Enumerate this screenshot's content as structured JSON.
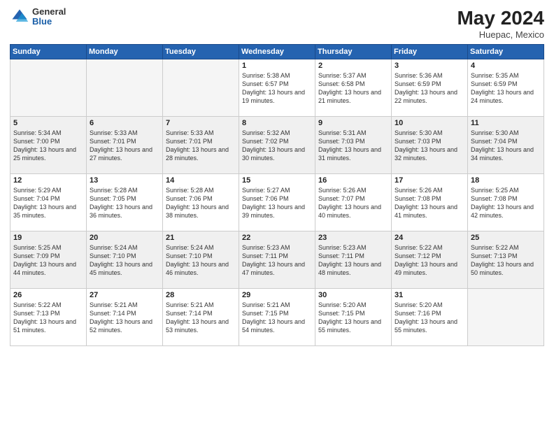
{
  "header": {
    "logo_general": "General",
    "logo_blue": "Blue",
    "title": "May 2024",
    "location": "Huepac, Mexico"
  },
  "days_of_week": [
    "Sunday",
    "Monday",
    "Tuesday",
    "Wednesday",
    "Thursday",
    "Friday",
    "Saturday"
  ],
  "weeks": [
    [
      {
        "day": "",
        "info": ""
      },
      {
        "day": "",
        "info": ""
      },
      {
        "day": "",
        "info": ""
      },
      {
        "day": "1",
        "info": "Sunrise: 5:38 AM\nSunset: 6:57 PM\nDaylight: 13 hours\nand 19 minutes."
      },
      {
        "day": "2",
        "info": "Sunrise: 5:37 AM\nSunset: 6:58 PM\nDaylight: 13 hours\nand 21 minutes."
      },
      {
        "day": "3",
        "info": "Sunrise: 5:36 AM\nSunset: 6:59 PM\nDaylight: 13 hours\nand 22 minutes."
      },
      {
        "day": "4",
        "info": "Sunrise: 5:35 AM\nSunset: 6:59 PM\nDaylight: 13 hours\nand 24 minutes."
      }
    ],
    [
      {
        "day": "5",
        "info": "Sunrise: 5:34 AM\nSunset: 7:00 PM\nDaylight: 13 hours\nand 25 minutes."
      },
      {
        "day": "6",
        "info": "Sunrise: 5:33 AM\nSunset: 7:01 PM\nDaylight: 13 hours\nand 27 minutes."
      },
      {
        "day": "7",
        "info": "Sunrise: 5:33 AM\nSunset: 7:01 PM\nDaylight: 13 hours\nand 28 minutes."
      },
      {
        "day": "8",
        "info": "Sunrise: 5:32 AM\nSunset: 7:02 PM\nDaylight: 13 hours\nand 30 minutes."
      },
      {
        "day": "9",
        "info": "Sunrise: 5:31 AM\nSunset: 7:03 PM\nDaylight: 13 hours\nand 31 minutes."
      },
      {
        "day": "10",
        "info": "Sunrise: 5:30 AM\nSunset: 7:03 PM\nDaylight: 13 hours\nand 32 minutes."
      },
      {
        "day": "11",
        "info": "Sunrise: 5:30 AM\nSunset: 7:04 PM\nDaylight: 13 hours\nand 34 minutes."
      }
    ],
    [
      {
        "day": "12",
        "info": "Sunrise: 5:29 AM\nSunset: 7:04 PM\nDaylight: 13 hours\nand 35 minutes."
      },
      {
        "day": "13",
        "info": "Sunrise: 5:28 AM\nSunset: 7:05 PM\nDaylight: 13 hours\nand 36 minutes."
      },
      {
        "day": "14",
        "info": "Sunrise: 5:28 AM\nSunset: 7:06 PM\nDaylight: 13 hours\nand 38 minutes."
      },
      {
        "day": "15",
        "info": "Sunrise: 5:27 AM\nSunset: 7:06 PM\nDaylight: 13 hours\nand 39 minutes."
      },
      {
        "day": "16",
        "info": "Sunrise: 5:26 AM\nSunset: 7:07 PM\nDaylight: 13 hours\nand 40 minutes."
      },
      {
        "day": "17",
        "info": "Sunrise: 5:26 AM\nSunset: 7:08 PM\nDaylight: 13 hours\nand 41 minutes."
      },
      {
        "day": "18",
        "info": "Sunrise: 5:25 AM\nSunset: 7:08 PM\nDaylight: 13 hours\nand 42 minutes."
      }
    ],
    [
      {
        "day": "19",
        "info": "Sunrise: 5:25 AM\nSunset: 7:09 PM\nDaylight: 13 hours\nand 44 minutes."
      },
      {
        "day": "20",
        "info": "Sunrise: 5:24 AM\nSunset: 7:10 PM\nDaylight: 13 hours\nand 45 minutes."
      },
      {
        "day": "21",
        "info": "Sunrise: 5:24 AM\nSunset: 7:10 PM\nDaylight: 13 hours\nand 46 minutes."
      },
      {
        "day": "22",
        "info": "Sunrise: 5:23 AM\nSunset: 7:11 PM\nDaylight: 13 hours\nand 47 minutes."
      },
      {
        "day": "23",
        "info": "Sunrise: 5:23 AM\nSunset: 7:11 PM\nDaylight: 13 hours\nand 48 minutes."
      },
      {
        "day": "24",
        "info": "Sunrise: 5:22 AM\nSunset: 7:12 PM\nDaylight: 13 hours\nand 49 minutes."
      },
      {
        "day": "25",
        "info": "Sunrise: 5:22 AM\nSunset: 7:13 PM\nDaylight: 13 hours\nand 50 minutes."
      }
    ],
    [
      {
        "day": "26",
        "info": "Sunrise: 5:22 AM\nSunset: 7:13 PM\nDaylight: 13 hours\nand 51 minutes."
      },
      {
        "day": "27",
        "info": "Sunrise: 5:21 AM\nSunset: 7:14 PM\nDaylight: 13 hours\nand 52 minutes."
      },
      {
        "day": "28",
        "info": "Sunrise: 5:21 AM\nSunset: 7:14 PM\nDaylight: 13 hours\nand 53 minutes."
      },
      {
        "day": "29",
        "info": "Sunrise: 5:21 AM\nSunset: 7:15 PM\nDaylight: 13 hours\nand 54 minutes."
      },
      {
        "day": "30",
        "info": "Sunrise: 5:20 AM\nSunset: 7:15 PM\nDaylight: 13 hours\nand 55 minutes."
      },
      {
        "day": "31",
        "info": "Sunrise: 5:20 AM\nSunset: 7:16 PM\nDaylight: 13 hours\nand 55 minutes."
      },
      {
        "day": "",
        "info": ""
      }
    ]
  ]
}
